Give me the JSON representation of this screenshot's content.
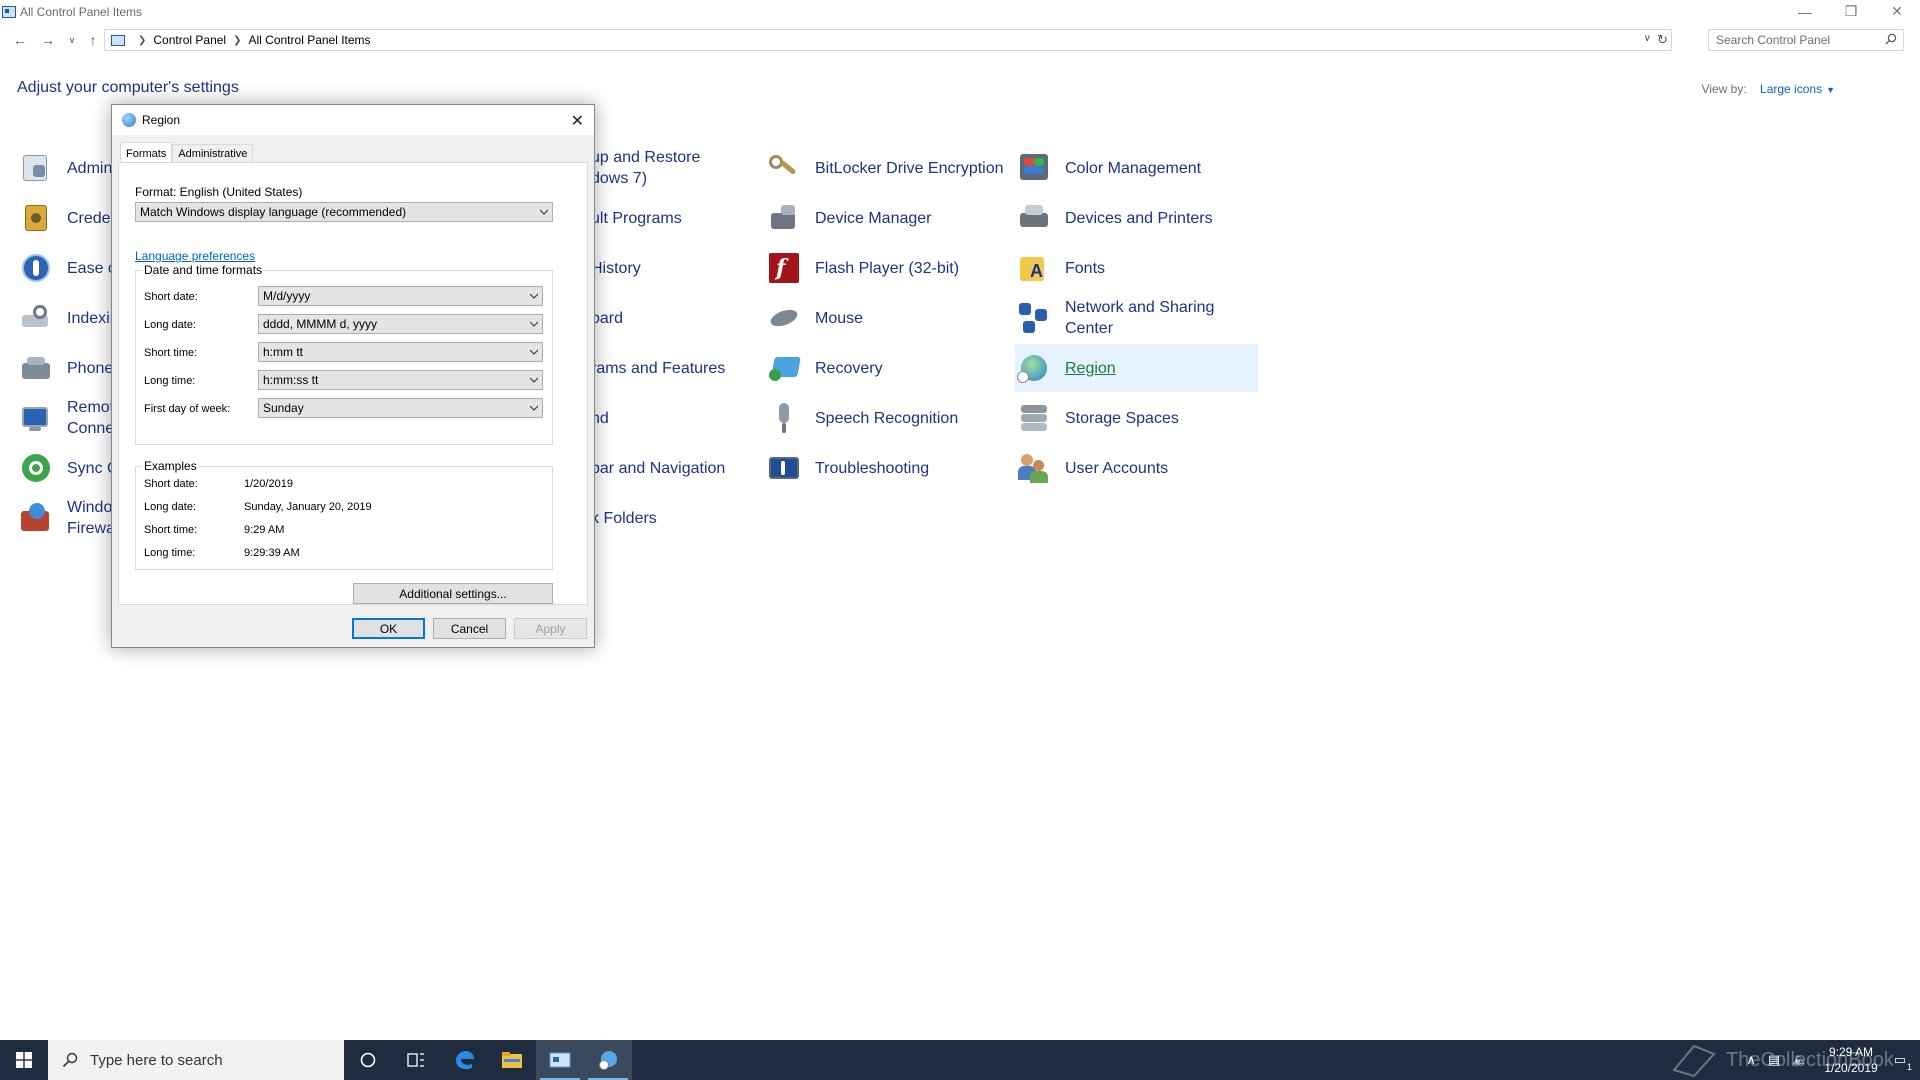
{
  "window": {
    "title": "All Control Panel Items",
    "breadcrumb": [
      "Control Panel",
      "All Control Panel Items"
    ],
    "search_placeholder": "Search Control Panel",
    "header": "Adjust your computer's settings",
    "view_by_label": "View by:",
    "view_by_value": "Large icons"
  },
  "items": {
    "c1": [
      "Admini",
      "Creden",
      "Ease of",
      "Indexin",
      "Phone",
      "Remote\nConnec",
      "Sync Ce",
      "Windo\nFirewa"
    ],
    "c2": [
      "up and Restore\ndows 7)",
      "ult Programs",
      "History",
      "oard",
      "rams and Features",
      "nd",
      "bar and Navigation",
      "k Folders"
    ],
    "c3": [
      "BitLocker Drive Encryption",
      "Device Manager",
      "Flash Player (32-bit)",
      "Mouse",
      "Recovery",
      "Speech Recognition",
      "Troubleshooting"
    ],
    "c4": [
      "Color Management",
      "Devices and Printers",
      "Fonts",
      "Network and Sharing\nCenter",
      "Region",
      "Storage Spaces",
      "User Accounts"
    ]
  },
  "dialog": {
    "title": "Region",
    "tabs": [
      "Formats",
      "Administrative"
    ],
    "format_label": "Format: English (United States)",
    "format_value": "Match Windows display language (recommended)",
    "language_link": "Language preferences",
    "dt_group": "Date and time formats",
    "rows": [
      {
        "label": "Short date:",
        "value": "M/d/yyyy"
      },
      {
        "label": "Long date:",
        "value": "dddd, MMMM d, yyyy"
      },
      {
        "label": "Short time:",
        "value": "h:mm tt"
      },
      {
        "label": "Long time:",
        "value": "h:mm:ss tt"
      },
      {
        "label": "First day of week:",
        "value": "Sunday"
      }
    ],
    "examples_group": "Examples",
    "examples": [
      {
        "label": "Short date:",
        "value": "1/20/2019"
      },
      {
        "label": "Long date:",
        "value": "Sunday, January 20, 2019"
      },
      {
        "label": "Short time:",
        "value": "9:29 AM"
      },
      {
        "label": "Long time:",
        "value": "9:29:39 AM"
      }
    ],
    "additional_btn": "Additional settings...",
    "ok": "OK",
    "cancel": "Cancel",
    "apply": "Apply"
  },
  "taskbar": {
    "search_placeholder": "Type here to search",
    "time": "9:29 AM",
    "date": "1/20/2019",
    "watermark": "TheCollectionBook",
    "notification_count": "1"
  },
  "colors": {
    "link": "#1e3287",
    "selected_bg": "#e5f3ff",
    "taskbar": "#1f2c3f"
  }
}
